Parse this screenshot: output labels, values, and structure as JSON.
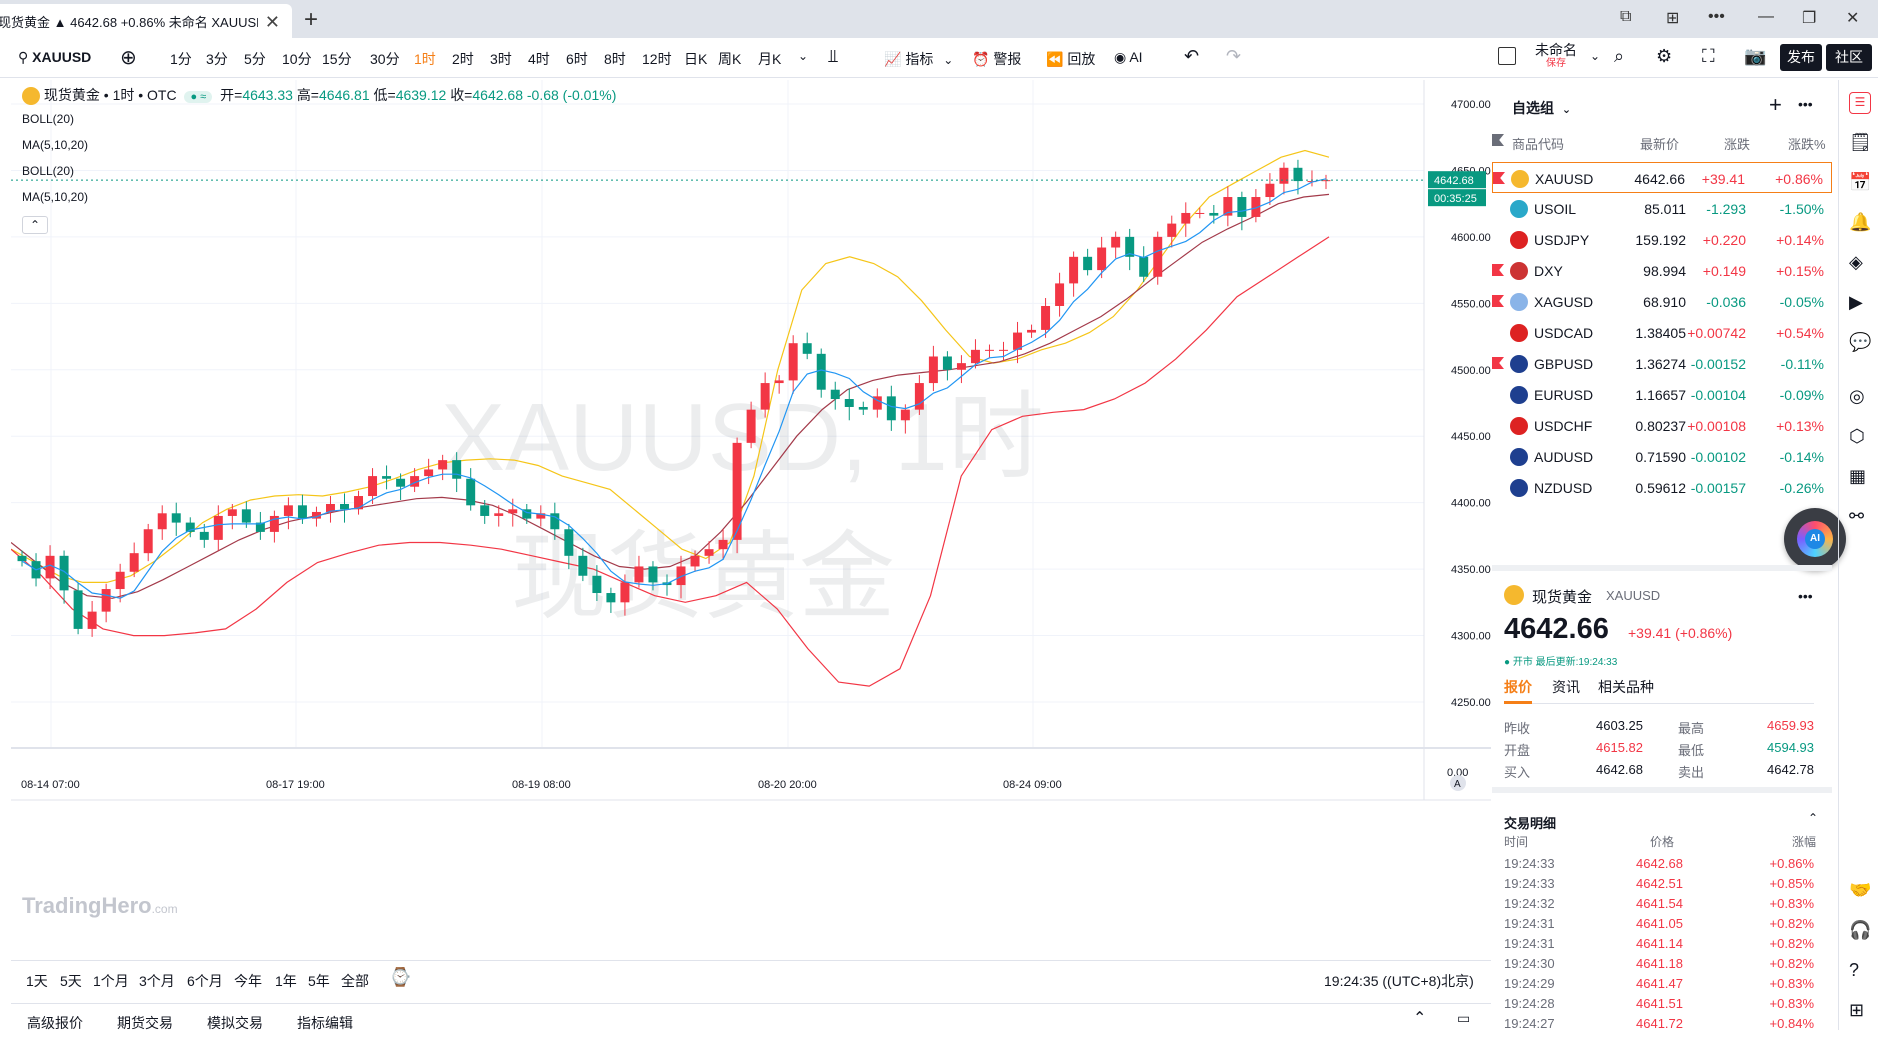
{
  "window": {
    "tab_title": "现货黄金 ▲ 4642.68 +0.86% 未命名 XAUUSD",
    "new_tab": "+",
    "close": "✕",
    "controls": [
      "⧉",
      "⊞",
      "•••",
      "—",
      "❐",
      "✕"
    ]
  },
  "toolbar": {
    "symbol": "XAUUSD",
    "intervals": [
      "1分",
      "3分",
      "5分",
      "10分",
      "15分",
      "30分",
      "1时",
      "2时",
      "3时",
      "4时",
      "6时",
      "8时",
      "12时",
      "日K",
      "周K",
      "月K"
    ],
    "active_interval": "1时",
    "indicators": "指标",
    "alert": "警报",
    "replay": "回放",
    "ai": "AI",
    "layout_name": "未命名",
    "layout_saved": "保存",
    "publish": "发布",
    "community": "社区"
  },
  "legend": {
    "name": "现货黄金 • 1时 • OTC",
    "open_label": "开=",
    "open": "4643.33",
    "high_label": "高=",
    "high": "4646.81",
    "low_label": "低=",
    "low": "4639.12",
    "close_label": "收=",
    "close": "4642.68",
    "change": "-0.68 (-0.01%)",
    "indicators": [
      "BOLL(20)",
      "MA(5,10,20)",
      "BOLL(20)",
      "MA(5,10,20)"
    ]
  },
  "watermark": {
    "symbol": "XAUUSD, 1时",
    "name": "现货黄金",
    "brand": "TradingHero",
    "brand_suffix": ".com"
  },
  "chart_data": {
    "type": "candlestick",
    "y_ticks": [
      "4700.00",
      "4650.00",
      "4600.00",
      "4550.00",
      "4500.00",
      "4450.00",
      "4400.00",
      "4350.00",
      "4300.00",
      "4250.00"
    ],
    "y_bottom_label": "0.00",
    "x_ticks": [
      "08-14 07:00",
      "08-17 19:00",
      "08-19 08:00",
      "08-20 20:00",
      "08-24 09:00"
    ],
    "last_price": "4642.68",
    "countdown": "00:35:25",
    "timezone_label": "A",
    "close_path": [
      4356,
      4343,
      4360,
      4334,
      4305,
      4318,
      4335,
      4348,
      4362,
      4380,
      4392,
      4385,
      4378,
      4372,
      4390,
      4395,
      4385,
      4378,
      4390,
      4398,
      4388,
      4393,
      4399,
      4395,
      4405,
      4420,
      4418,
      4412,
      4420,
      4425,
      4432,
      4418,
      4398,
      4390,
      4392,
      4395,
      4388,
      4392,
      4380,
      4360,
      4345,
      4332,
      4325,
      4340,
      4352,
      4340,
      4338,
      4352,
      4360,
      4365,
      4372,
      4445,
      4470,
      4490,
      4492,
      4520,
      4512,
      4485,
      4478,
      4472,
      4470,
      4480,
      4462,
      4470,
      4490,
      4510,
      4500,
      4505,
      4515,
      4515,
      4515,
      4528,
      4530,
      4548,
      4565,
      4585,
      4575,
      4592,
      4600,
      4585,
      4570,
      4600,
      4610,
      4618,
      4618,
      4616,
      4630,
      4615,
      4630,
      4640,
      4652,
      4642,
      4642,
      4642.68
    ],
    "boll_upper": [
      4365,
      4355,
      4345,
      4340,
      4340,
      4345,
      4356,
      4370,
      4385,
      4395,
      4402,
      4405,
      4406,
      4405,
      4408,
      4412,
      4418,
      4425,
      4430,
      4432,
      4433,
      4432,
      4428,
      4420,
      4415,
      4410,
      4395,
      4380,
      4365,
      4358,
      4370,
      4420,
      4500,
      4560,
      4580,
      4585,
      4580,
      4570,
      4552,
      4530,
      4510,
      4505,
      4508,
      4515,
      4520,
      4528,
      4540,
      4560,
      4585,
      4610,
      4630,
      4640,
      4650,
      4660,
      4665,
      4660
    ],
    "boll_middle": [
      4370,
      4355,
      4340,
      4330,
      4328,
      4333,
      4342,
      4352,
      4362,
      4372,
      4380,
      4386,
      4390,
      4394,
      4397,
      4400,
      4403,
      4404,
      4402,
      4398,
      4390,
      4380,
      4370,
      4360,
      4352,
      4350,
      4352,
      4360,
      4378,
      4400,
      4425,
      4450,
      4470,
      4485,
      4492,
      4496,
      4498,
      4500,
      4503,
      4506,
      4512,
      4520,
      4530,
      4540,
      4553,
      4568,
      4582,
      4596,
      4606,
      4615,
      4625,
      4630,
      4632
    ],
    "boll_lower": [
      4365,
      4345,
      4320,
      4305,
      4300,
      4300,
      4302,
      4305,
      4320,
      4340,
      4355,
      4362,
      4368,
      4370,
      4370,
      4368,
      4365,
      4360,
      4355,
      4350,
      4340,
      4330,
      4325,
      4330,
      4340,
      4320,
      4290,
      4265,
      4262,
      4275,
      4330,
      4420,
      4455,
      4465,
      4468,
      4470,
      4478,
      4490,
      4508,
      4530,
      4555,
      4570,
      4585,
      4600
    ]
  },
  "ranges": [
    "1天",
    "5天",
    "1个月",
    "3个月",
    "6个月",
    "今年",
    "1年",
    "5年",
    "全部"
  ],
  "clock": "19:24:35 ((UTC+8)北京)",
  "bottom_tabs": [
    "高级报价",
    "期货交易",
    "模拟交易",
    "指标编辑"
  ],
  "watchlist": {
    "title": "自选组",
    "headers": [
      "商品代码",
      "最新价",
      "涨跌",
      "涨跌%"
    ],
    "rows": [
      {
        "symbol": "XAUUSD",
        "last": "4642.66",
        "chg": "+39.41",
        "pct": "+0.86%",
        "dir": "up",
        "flag": true,
        "selected": true,
        "icon_color": "#f5b82e"
      },
      {
        "symbol": "USOIL",
        "last": "85.011",
        "chg": "-1.293",
        "pct": "-1.50%",
        "dir": "down",
        "flag": false,
        "selected": false,
        "icon_color": "#2aa8c9"
      },
      {
        "symbol": "USDJPY",
        "last": "159.192",
        "chg": "+0.220",
        "pct": "+0.14%",
        "dir": "up",
        "flag": false,
        "selected": false,
        "icon_color": "#d22"
      },
      {
        "symbol": "DXY",
        "last": "98.994",
        "chg": "+0.149",
        "pct": "+0.15%",
        "dir": "up",
        "flag": true,
        "selected": false,
        "icon_color": "#c33"
      },
      {
        "symbol": "XAGUSD",
        "last": "68.910",
        "chg": "-0.036",
        "pct": "-0.05%",
        "dir": "down",
        "flag": true,
        "selected": false,
        "icon_color": "#8ab4e8"
      },
      {
        "symbol": "USDCAD",
        "last": "1.38405",
        "chg": "+0.00742",
        "pct": "+0.54%",
        "dir": "up",
        "flag": false,
        "selected": false,
        "icon_color": "#d22"
      },
      {
        "symbol": "GBPUSD",
        "last": "1.36274",
        "chg": "-0.00152",
        "pct": "-0.11%",
        "dir": "down",
        "flag": true,
        "selected": false,
        "icon_color": "#1e3f8f"
      },
      {
        "symbol": "EURUSD",
        "last": "1.16657",
        "chg": "-0.00104",
        "pct": "-0.09%",
        "dir": "down",
        "flag": false,
        "selected": false,
        "icon_color": "#1e3f8f"
      },
      {
        "symbol": "USDCHF",
        "last": "0.80237",
        "chg": "+0.00108",
        "pct": "+0.13%",
        "dir": "up",
        "flag": false,
        "selected": false,
        "icon_color": "#d22"
      },
      {
        "symbol": "AUDUSD",
        "last": "0.71590",
        "chg": "-0.00102",
        "pct": "-0.14%",
        "dir": "down",
        "flag": false,
        "selected": false,
        "icon_color": "#1e3f8f"
      },
      {
        "symbol": "NZDUSD",
        "last": "0.59612",
        "chg": "-0.00157",
        "pct": "-0.26%",
        "dir": "down",
        "flag": false,
        "selected": false,
        "icon_color": "#1e3f8f"
      }
    ]
  },
  "detail": {
    "name": "现货黄金",
    "symbol": "XAUUSD",
    "price": "4642.66",
    "change": "+39.41 (+0.86%)",
    "status": "● 开市 最后更新:19:24:33",
    "tabs": [
      "报价",
      "资讯",
      "相关品种"
    ],
    "stats": [
      {
        "label": "昨收",
        "value": "4603.25",
        "label2": "最高",
        "value2": "4659.93"
      },
      {
        "label": "开盘",
        "value": "4615.82",
        "label2": "最低",
        "value2": "4594.93"
      },
      {
        "label": "买入",
        "value": "4642.68",
        "label2": "卖出",
        "value2": "4642.78"
      }
    ],
    "trades_title": "交易明细",
    "trade_headers": [
      "时间",
      "价格",
      "涨幅"
    ],
    "trades": [
      {
        "time": "19:24:33",
        "price": "4642.68",
        "pct": "+0.86%"
      },
      {
        "time": "19:24:33",
        "price": "4642.51",
        "pct": "+0.85%"
      },
      {
        "time": "19:24:32",
        "price": "4641.54",
        "pct": "+0.83%"
      },
      {
        "time": "19:24:31",
        "price": "4641.05",
        "pct": "+0.82%"
      },
      {
        "time": "19:24:31",
        "price": "4641.14",
        "pct": "+0.82%"
      },
      {
        "time": "19:24:30",
        "price": "4641.18",
        "pct": "+0.82%"
      },
      {
        "time": "19:24:29",
        "price": "4641.47",
        "pct": "+0.83%"
      },
      {
        "time": "19:24:28",
        "price": "4641.51",
        "pct": "+0.83%"
      },
      {
        "time": "19:24:27",
        "price": "4641.72",
        "pct": "+0.84%"
      }
    ]
  },
  "colors": {
    "up": "#f23645",
    "down": "#089981",
    "boll_band": "#f5c518",
    "boll_mid": "#a33a4a",
    "ma": "#2196f3",
    "accent": "#f57f17"
  }
}
